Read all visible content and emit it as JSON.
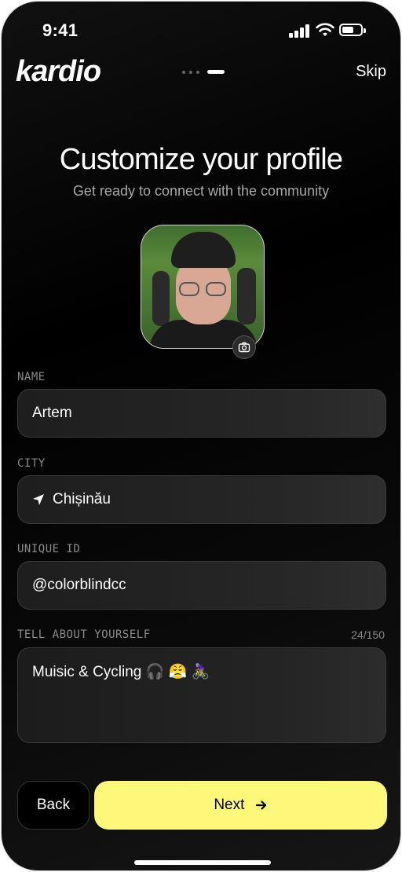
{
  "status_bar": {
    "time": "9:41"
  },
  "header": {
    "logo": "kardio",
    "skip_label": "Skip"
  },
  "progress": {
    "total_steps": 4,
    "current_step": 4
  },
  "intro": {
    "title": "Customize your profile",
    "subtitle": "Get ready to connect with the community"
  },
  "avatar": {
    "icon": "camera-icon"
  },
  "form": {
    "name": {
      "label": "NAME",
      "value": "Artem"
    },
    "city": {
      "label": "CITY",
      "value": "Chișinău",
      "icon": "location-arrow-icon"
    },
    "unique_id": {
      "label": "UNIQUE ID",
      "value": "@colorblindcc"
    },
    "about": {
      "label": "TELL ABOUT YOURSELF",
      "counter": "24/150",
      "value": "Muisic & Cycling 🎧 😤 🚴🏽‍♀️"
    }
  },
  "actions": {
    "back_label": "Back",
    "next_label": "Next"
  },
  "colors": {
    "accent": "#FDF77A",
    "background": "#000000",
    "field": "#222222"
  }
}
